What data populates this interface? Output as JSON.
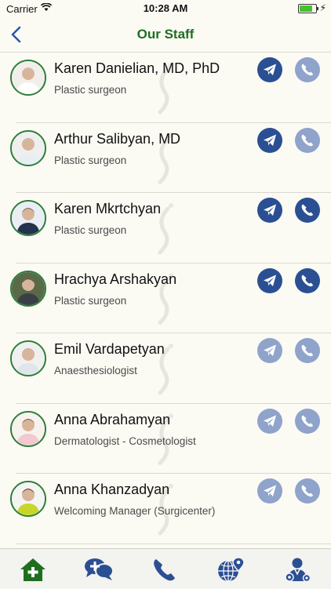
{
  "status_bar": {
    "carrier": "Carrier",
    "time": "10:28 AM",
    "battery_level": 0.85
  },
  "nav": {
    "title": "Our Staff",
    "back_icon": "chevron-left-icon"
  },
  "colors": {
    "accent_green": "#1f6e20",
    "button_active": "#2b4f93",
    "button_inactive": "#8fa3cb"
  },
  "staff": [
    {
      "name": "Karen Danielian, MD, PhD",
      "role": "Plastic surgeon",
      "message_enabled": true,
      "call_enabled": false
    },
    {
      "name": "Arthur Salibyan, MD",
      "role": "Plastic surgeon",
      "message_enabled": true,
      "call_enabled": false
    },
    {
      "name": "Karen Mkrtchyan",
      "role": "Plastic surgeon",
      "message_enabled": true,
      "call_enabled": true
    },
    {
      "name": "Hrachya Arshakyan",
      "role": "Plastic surgeon",
      "message_enabled": true,
      "call_enabled": true
    },
    {
      "name": "Emil Vardapetyan",
      "role": "Anaesthesiologist",
      "message_enabled": false,
      "call_enabled": false
    },
    {
      "name": "Anna Abrahamyan",
      "role": "Dermatologist - Cosmetologist",
      "message_enabled": false,
      "call_enabled": false
    },
    {
      "name": "Anna Khanzadyan",
      "role": "Welcoming Manager (Surgicenter)",
      "message_enabled": false,
      "call_enabled": false
    }
  ],
  "tabs": [
    {
      "icon": "home-plus-icon"
    },
    {
      "icon": "chat-bubbles-icon"
    },
    {
      "icon": "phone-icon"
    },
    {
      "icon": "globe-pin-icon"
    },
    {
      "icon": "staff-settings-icon"
    }
  ]
}
